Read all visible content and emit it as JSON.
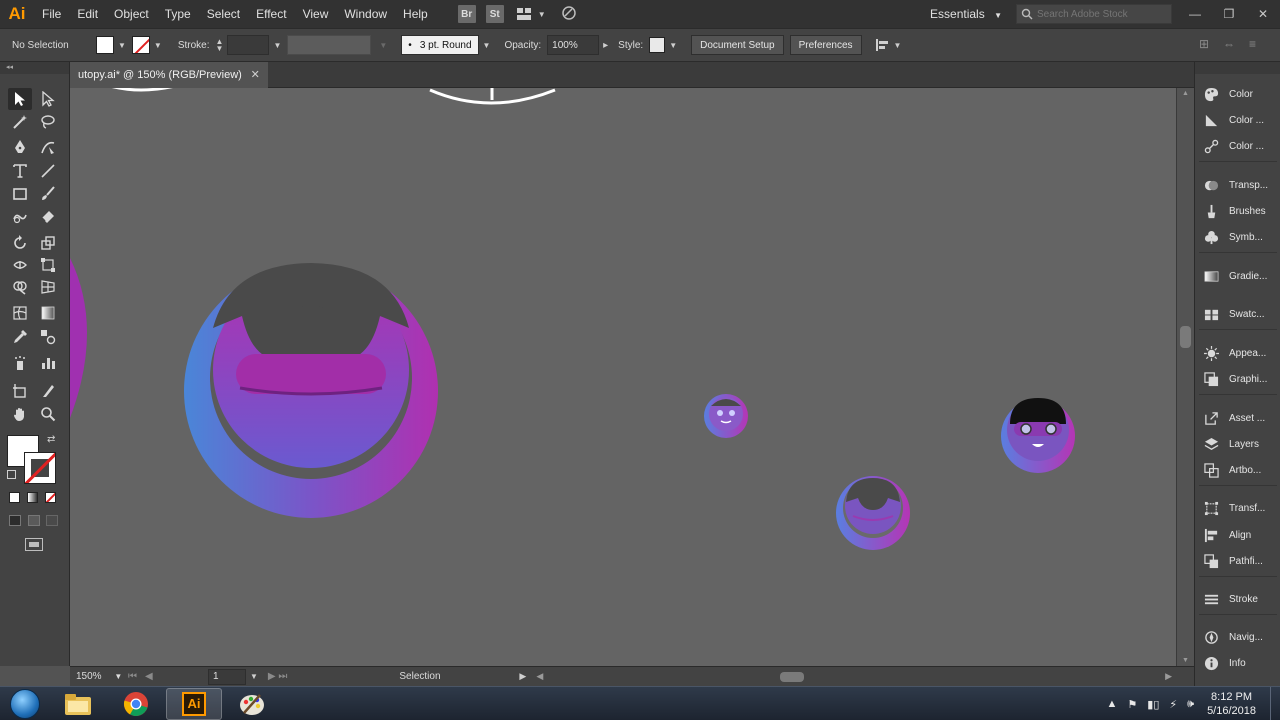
{
  "app": {
    "logo": "Ai",
    "menu": [
      "File",
      "Edit",
      "Object",
      "Type",
      "Select",
      "Effect",
      "View",
      "Window",
      "Help"
    ],
    "bridge_label": "Br",
    "stock_label": "St",
    "workspace": "Essentials",
    "search_placeholder": "Search Adobe Stock"
  },
  "controlbar": {
    "selection_status": "No Selection",
    "stroke_label": "Stroke:",
    "stroke_profile": "3 pt. Round",
    "opacity_label": "Opacity:",
    "opacity_value": "100%",
    "style_label": "Style:",
    "document_setup": "Document Setup",
    "preferences": "Preferences"
  },
  "document": {
    "tab_title": "utopy.ai* @ 150% (RGB/Preview)",
    "close": "✕"
  },
  "statusbar": {
    "zoom": "150%",
    "artboard": "1",
    "current_tool": "Selection"
  },
  "right_panels": [
    {
      "label": "Color",
      "icon": "palette-icon"
    },
    {
      "label": "Color ...",
      "icon": "color-guide-icon"
    },
    {
      "label": "Color ...",
      "icon": "color-themes-icon"
    },
    {
      "label": "Transp...",
      "icon": "transparency-icon"
    },
    {
      "label": "Brushes",
      "icon": "brush-icon"
    },
    {
      "label": "Symb...",
      "icon": "symbols-icon"
    },
    {
      "label": "Gradie...",
      "icon": "gradient-icon"
    },
    {
      "label": "Swatc...",
      "icon": "swatches-icon"
    },
    {
      "label": "Appea...",
      "icon": "appearance-icon"
    },
    {
      "label": "Graphi...",
      "icon": "graphic-styles-icon"
    },
    {
      "label": "Asset ...",
      "icon": "asset-export-icon"
    },
    {
      "label": "Layers",
      "icon": "layers-icon"
    },
    {
      "label": "Artbo...",
      "icon": "artboards-icon"
    },
    {
      "label": "Transf...",
      "icon": "transform-icon"
    },
    {
      "label": "Align",
      "icon": "align-icon"
    },
    {
      "label": "Pathfi...",
      "icon": "pathfinder-icon"
    },
    {
      "label": "Stroke",
      "icon": "stroke-icon"
    },
    {
      "label": "Navig...",
      "icon": "navigator-icon"
    },
    {
      "label": "Info",
      "icon": "info-icon"
    }
  ],
  "taskbar": {
    "ai_label": "Ai",
    "time": "8:12 PM",
    "date": "5/16/2018"
  },
  "colors": {
    "accent_orange": "#ff9a00",
    "canvas_bg": "#646464",
    "purple": "#7a55c8",
    "magenta": "#b030b0",
    "blue": "#4a86d8",
    "dark_gray": "#4a4a4a"
  }
}
